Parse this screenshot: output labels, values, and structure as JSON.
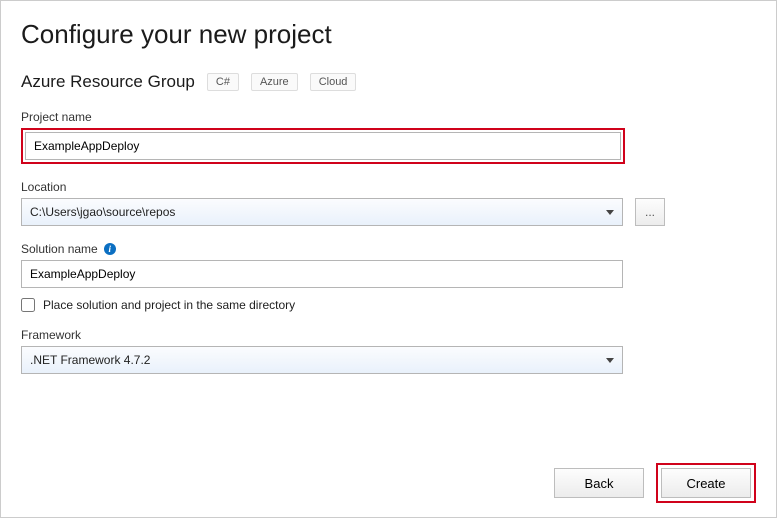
{
  "header": {
    "title": "Configure your new project",
    "template_name": "Azure Resource Group",
    "tags": [
      "C#",
      "Azure",
      "Cloud"
    ]
  },
  "project_name": {
    "label": "Project name",
    "value": "ExampleAppDeploy"
  },
  "location": {
    "label": "Location",
    "value": "C:\\Users\\jgao\\source\\repos",
    "browse_label": "..."
  },
  "solution_name": {
    "label": "Solution name",
    "value": "ExampleAppDeploy"
  },
  "same_dir": {
    "label": "Place solution and project in the same directory",
    "checked": false
  },
  "framework": {
    "label": "Framework",
    "value": ".NET Framework 4.7.2"
  },
  "footer": {
    "back": "Back",
    "create": "Create"
  }
}
